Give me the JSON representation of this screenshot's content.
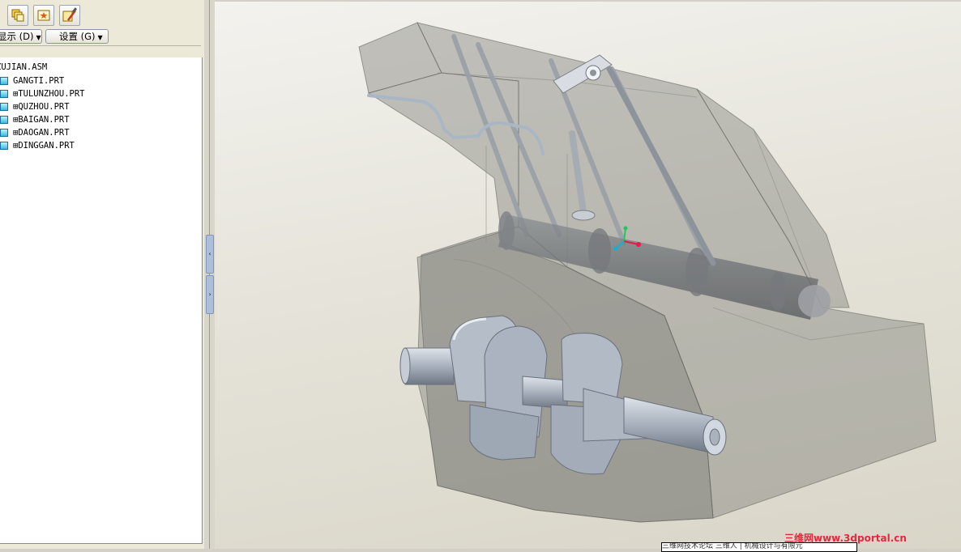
{
  "toolbar": {
    "icons": [
      "layers-icon",
      "settings-star-icon",
      "tools-icon"
    ]
  },
  "menubar": {
    "show_label": "显示 (D)",
    "settings_label": "设置 (G)"
  },
  "model_tree": {
    "root": "ZUJIAN.ASM",
    "items": [
      {
        "label": "GANGTI.PRT"
      },
      {
        "label": "TULUNZHOU.PRT"
      },
      {
        "label": "QUZHOU.PRT"
      },
      {
        "label": "BAIGAN.PRT"
      },
      {
        "label": "DAOGAN.PRT"
      },
      {
        "label": "DINGGAN.PRT"
      }
    ]
  },
  "statusbar": {
    "text": "三维网技术论坛 三维人 | 机械设计与有限元"
  },
  "watermark": {
    "text": "三维网www.3dportal.cn"
  },
  "colors": {
    "viewport_bg": "#e5e3da",
    "part_blue": "#3fb8e4",
    "housing": "#8f8f8c",
    "crank_metal": "#b6bec9",
    "watermark": "#e3293b"
  }
}
